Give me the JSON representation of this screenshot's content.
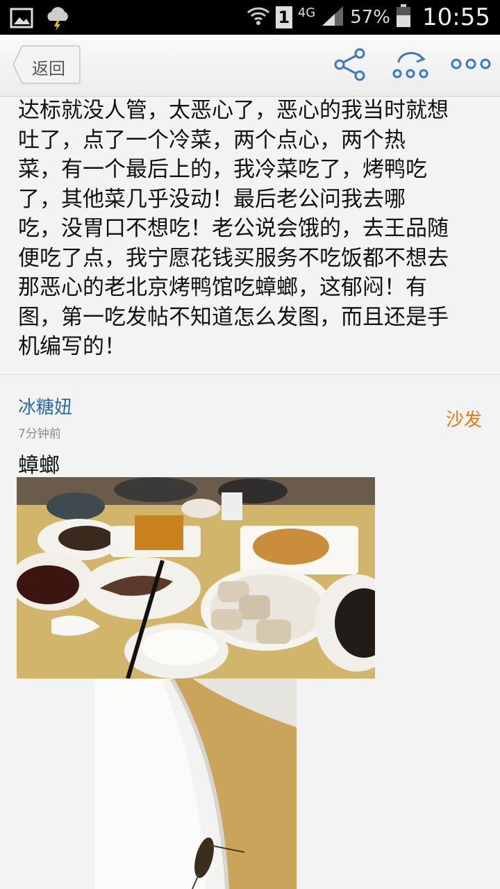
{
  "status_bar": {
    "sim_badge": "1",
    "network": "4G",
    "battery": "57%",
    "time": "10:55"
  },
  "nav": {
    "back_label": "返回"
  },
  "post": {
    "text": "达标就没人管，太恶心了，恶心的我当时就想\n吐了，点了一个冷菜，两个点心，两个热\n菜，有一个最后上的，我冷菜吃了，烤鸭吃\n了，其他菜几乎没动！最后老公问我去哪\n吃，没胃口不想吃！老公说会饿的，去王品随\n便吃了点，我宁愿花钱买服务不吃饭都不想去\n那恶心的老北京烤鸭馆吃蟑螂，这郁闷！有\n图，第一吃发帖不知道怎么发图，而且还是手\n机编写的！"
  },
  "reply": {
    "username": "冰糖妞",
    "time": "7分钟前",
    "badge": "沙发",
    "text": "蟑螂"
  },
  "colors": {
    "accent_link": "#2a6aa8",
    "badge": "#e8790e",
    "nav_icon": "#3a78c8"
  }
}
